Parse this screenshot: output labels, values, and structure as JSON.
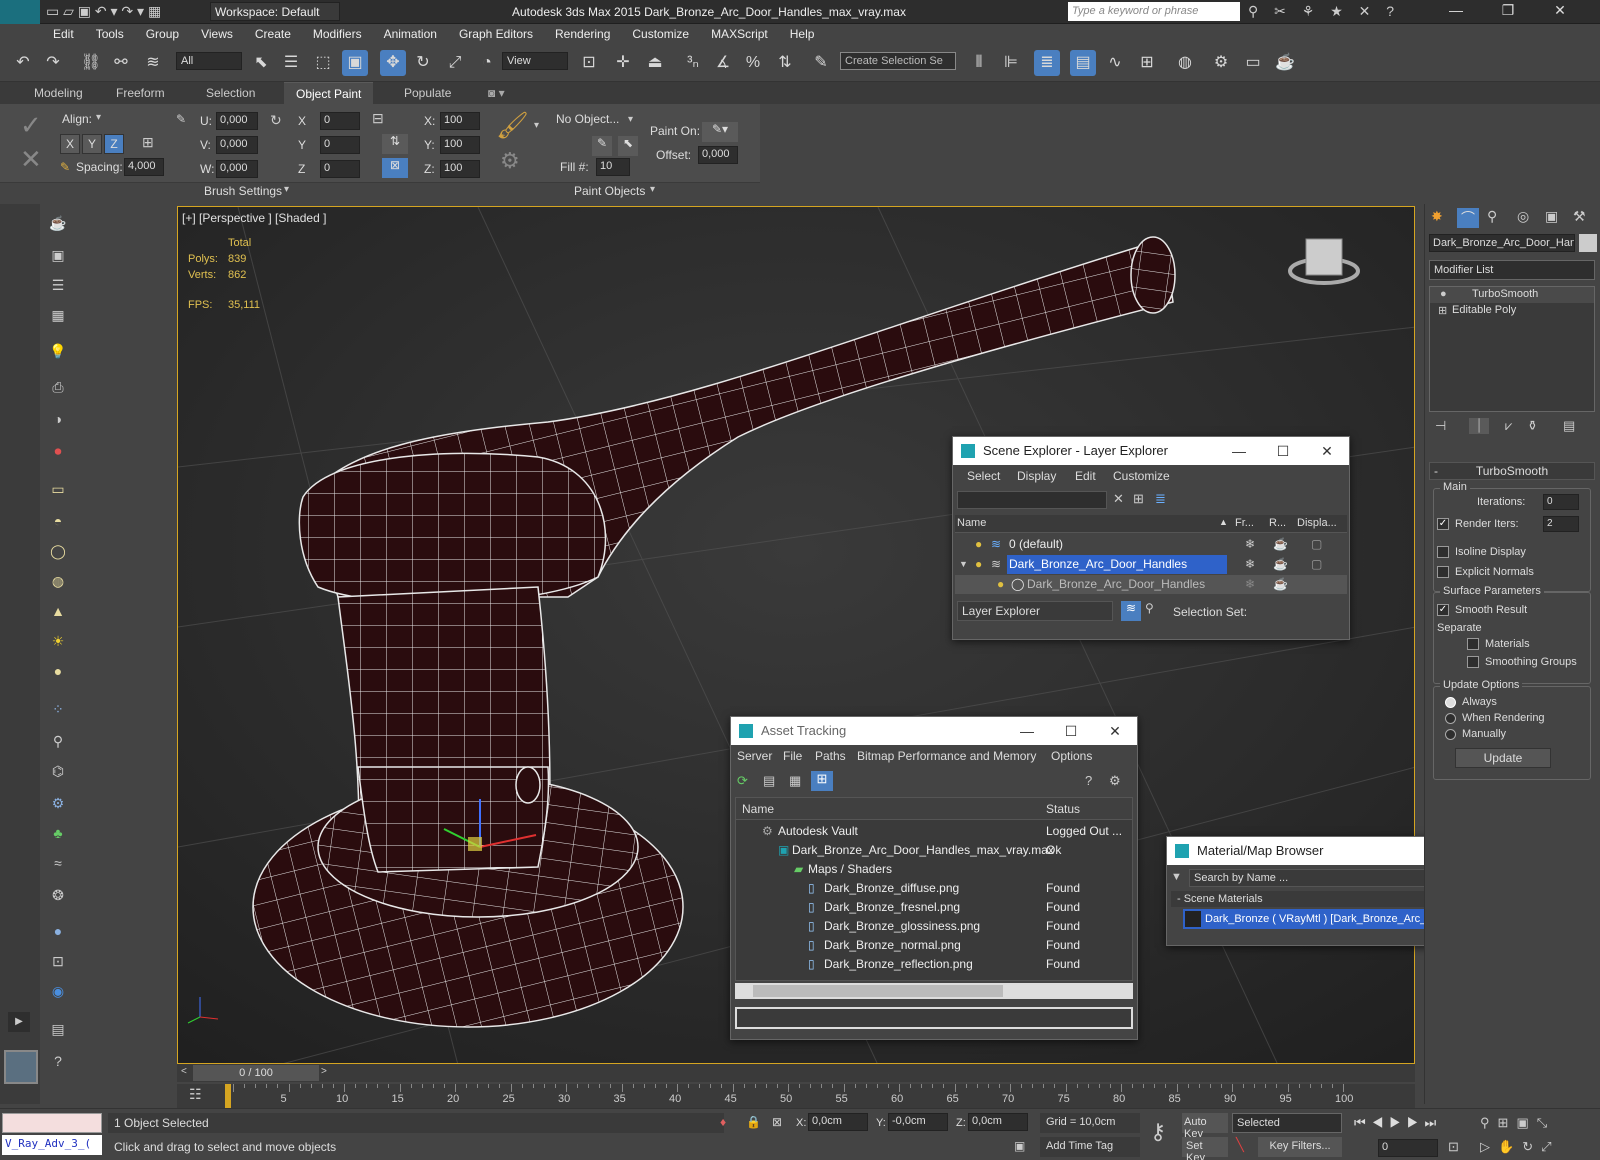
{
  "titlebar": {
    "app_title": "Autodesk 3ds Max  2015     Dark_Bronze_Arc_Door_Handles_max_vray.max",
    "workspace": "Workspace: Default",
    "search_placeholder": "Type a keyword or phrase",
    "logo": "MAX"
  },
  "menu": [
    "Edit",
    "Tools",
    "Group",
    "Views",
    "Create",
    "Modifiers",
    "Animation",
    "Graph Editors",
    "Rendering",
    "Customize",
    "MAXScript",
    "Help"
  ],
  "toolbar": {
    "filter": "All",
    "refcoord": "View",
    "selection_set": "Create Selection Se"
  },
  "ribbon": {
    "tabs": [
      "Modeling",
      "Freeform",
      "Selection",
      "Object Paint",
      "Populate"
    ],
    "active_tab": "Object Paint",
    "align_label": "Align:",
    "spacing_label": "Spacing:",
    "spacing_value": "4,000",
    "u_label": "U:",
    "u_value": "0,000",
    "v_label": "V:",
    "v_value": "0,000",
    "w_label": "W:",
    "w_value": "0,000",
    "x_label": "X",
    "x_value": "0",
    "y_label": "Y",
    "y_value": "0",
    "z_label": "Z",
    "z_value": "0",
    "sx_label": "X:",
    "sx_value": "100",
    "sy_label": "Y:",
    "sy_value": "100",
    "sz_label": "Z:",
    "sz_value": "100",
    "no_object": "No Object...",
    "fill_label": "Fill #:",
    "fill_value": "10",
    "paint_on_label": "Paint On:",
    "offset_label": "Offset:",
    "offset_value": "0,000",
    "brush_settings": "Brush Settings",
    "paint_objects": "Paint Objects",
    "axis_x": "X",
    "axis_y": "Y",
    "axis_z": "Z"
  },
  "viewport": {
    "label": "[+] [Perspective ] [Shaded ]",
    "total_label": "Total",
    "polys_label": "Polys:",
    "polys_value": "839",
    "verts_label": "Verts:",
    "verts_value": "862",
    "fps_label": "FPS:",
    "fps_value": "35,111"
  },
  "scene_explorer": {
    "title": "Scene Explorer - Layer Explorer",
    "menu": [
      "Select",
      "Display",
      "Edit",
      "Customize"
    ],
    "col_name": "Name",
    "col_freeze": "Fr...",
    "col_render": "R...",
    "col_display": "Displa...",
    "rows": [
      "0 (default)",
      "Dark_Bronze_Arc_Door_Handles",
      "Dark_Bronze_Arc_Door_Handles"
    ],
    "footer_dropdown": "Layer Explorer",
    "selection_set": "Selection Set:"
  },
  "asset_tracking": {
    "title": "Asset Tracking",
    "menu": [
      "Server",
      "File",
      "Paths",
      "Bitmap Performance and Memory",
      "Options"
    ],
    "col_name": "Name",
    "col_status": "Status",
    "rows": [
      {
        "name": "Autodesk Vault",
        "status": "Logged Out ..."
      },
      {
        "name": "Dark_Bronze_Arc_Door_Handles_max_vray.max",
        "status": "Ok"
      },
      {
        "name": "Maps / Shaders",
        "status": ""
      },
      {
        "name": "Dark_Bronze_diffuse.png",
        "status": "Found"
      },
      {
        "name": "Dark_Bronze_fresnel.png",
        "status": "Found"
      },
      {
        "name": "Dark_Bronze_glossiness.png",
        "status": "Found"
      },
      {
        "name": "Dark_Bronze_normal.png",
        "status": "Found"
      },
      {
        "name": "Dark_Bronze_reflection.png",
        "status": "Found"
      }
    ]
  },
  "material_browser": {
    "title": "Material/Map Browser",
    "search_placeholder": "Search by Name ...",
    "section": "- Scene Materials",
    "item": "Dark_Bronze  ( VRayMtl )  [Dark_Bronze_Arc_Door_Handles]"
  },
  "command_panel": {
    "object_name": "Dark_Bronze_Arc_Door_Hanc",
    "modifier_list": "Modifier List",
    "stack": [
      "TurboSmooth",
      "Editable Poly"
    ],
    "rollout_title": "TurboSmooth",
    "main_label": "Main",
    "iterations_label": "Iterations:",
    "iterations_value": "0",
    "render_iters_label": "Render Iters:",
    "render_iters_value": "2",
    "isoline": "Isoline Display",
    "explicit_normals": "Explicit Normals",
    "surface_params": "Surface Parameters",
    "smooth_result": "Smooth Result",
    "separate": "Separate",
    "materials": "Materials",
    "smoothing_groups": "Smoothing Groups",
    "update_options": "Update Options",
    "always": "Always",
    "when_rendering": "When Rendering",
    "manually": "Manually",
    "update_btn": "Update"
  },
  "timeline": {
    "frame": "0 / 100",
    "ticks": [
      "5",
      "10",
      "15",
      "20",
      "25",
      "30",
      "35",
      "40",
      "45",
      "50",
      "55",
      "60",
      "65",
      "70",
      "75",
      "80",
      "85",
      "90",
      "95",
      "100"
    ]
  },
  "status": {
    "script_label": "V_Ray_Adv_3_(",
    "selected": "1 Object Selected",
    "prompt": "Click and drag to select and move objects",
    "x_label": "X:",
    "x_value": "0,0cm",
    "y_label": "Y:",
    "y_value": "-0,0cm",
    "z_label": "Z:",
    "z_value": "0,0cm",
    "grid": "Grid = 10,0cm",
    "add_time_tag": "Add Time Tag",
    "auto_key": "Auto Key",
    "set_key": "Set Key",
    "selected_dropdown": "Selected",
    "key_filters": "Key Filters...",
    "frame_value": "0"
  }
}
